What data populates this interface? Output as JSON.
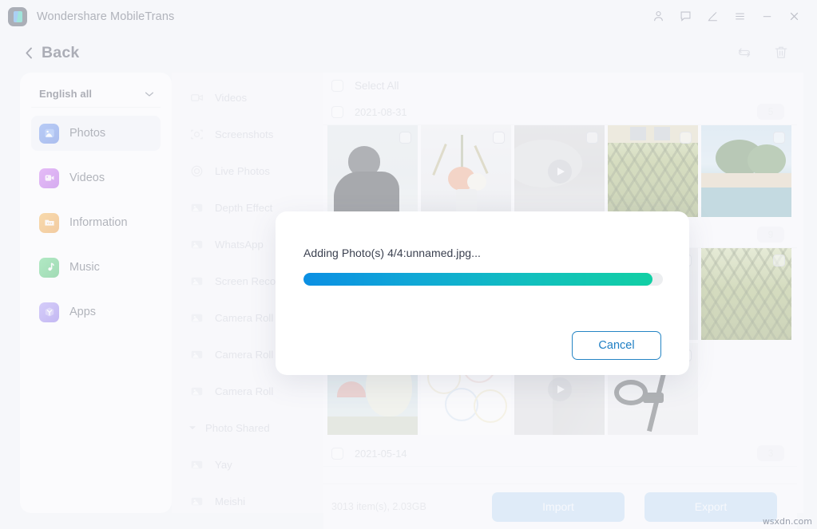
{
  "window": {
    "title": "Wondershare MobileTrans",
    "logo_icon": "mobiletrans-logo-icon",
    "controls": [
      {
        "name": "account-icon",
        "label": "Account"
      },
      {
        "name": "feedback-icon",
        "label": "Feedback"
      },
      {
        "name": "edit-pen-icon",
        "label": "Edit"
      },
      {
        "name": "menu-icon",
        "label": "Menu"
      },
      {
        "name": "minimize-icon",
        "label": "Minimize"
      },
      {
        "name": "close-icon",
        "label": "Close"
      }
    ]
  },
  "subheader": {
    "back_label": "Back",
    "back_icon": "chevron-left-icon",
    "tools": [
      {
        "name": "refresh-icon",
        "label": "Refresh"
      },
      {
        "name": "trash-icon",
        "label": "Delete"
      }
    ]
  },
  "sidebar": {
    "language": {
      "label": "English all",
      "chevron_icon": "chevron-down-icon"
    },
    "items": [
      {
        "label": "Photos",
        "icon": "photos-icon",
        "color": "#3b6fe0",
        "active": true
      },
      {
        "label": "Videos",
        "icon": "videos-icon",
        "color": "#b53fe0",
        "active": false
      },
      {
        "label": "Information",
        "icon": "information-icon",
        "color": "#ef8e1a",
        "active": false
      },
      {
        "label": "Music",
        "icon": "music-icon",
        "color": "#21b34f",
        "active": false
      },
      {
        "label": "Apps",
        "icon": "apps-icon",
        "color": "#7a5de8",
        "active": false
      }
    ]
  },
  "categories": {
    "items": [
      {
        "label": "Videos",
        "icon": "video-camera-icon",
        "type": "item"
      },
      {
        "label": "Screenshots",
        "icon": "screenshot-icon",
        "type": "item"
      },
      {
        "label": "Live Photos",
        "icon": "live-photo-icon",
        "type": "item"
      },
      {
        "label": "Depth Effect",
        "icon": "photo-album-icon",
        "type": "item"
      },
      {
        "label": "WhatsApp",
        "icon": "photo-album-icon",
        "type": "item"
      },
      {
        "label": "Screen Recorder",
        "icon": "photo-album-icon",
        "type": "item"
      },
      {
        "label": "Camera Roll",
        "icon": "photo-album-icon",
        "type": "item"
      },
      {
        "label": "Camera Roll",
        "icon": "photo-album-icon",
        "type": "item"
      },
      {
        "label": "Camera Roll",
        "icon": "photo-album-icon",
        "type": "item"
      },
      {
        "label": "Photo Shared",
        "icon": "triangle-down-icon",
        "type": "group"
      },
      {
        "label": "Yay",
        "icon": "photo-album-icon",
        "type": "item"
      },
      {
        "label": "Meishi",
        "icon": "photo-album-icon",
        "type": "item"
      }
    ]
  },
  "content": {
    "select_all_label": "Select All",
    "groups": [
      {
        "date": "2021-08-31",
        "count": "5"
      },
      {
        "date": "",
        "count": "9"
      },
      {
        "date": "2021-05-14",
        "count": "3"
      }
    ]
  },
  "bottom_bar": {
    "items_info": "3013 item(s), 2.03GB",
    "import_label": "Import",
    "export_label": "Export"
  },
  "modal": {
    "message": "Adding Photo(s) 4/4:unnamed.jpg...",
    "progress_percent": 97,
    "cancel_label": "Cancel",
    "progress_gradient_start": "#0b8fe3",
    "progress_gradient_end": "#11cfa4"
  },
  "watermark": "wsxdn.com"
}
